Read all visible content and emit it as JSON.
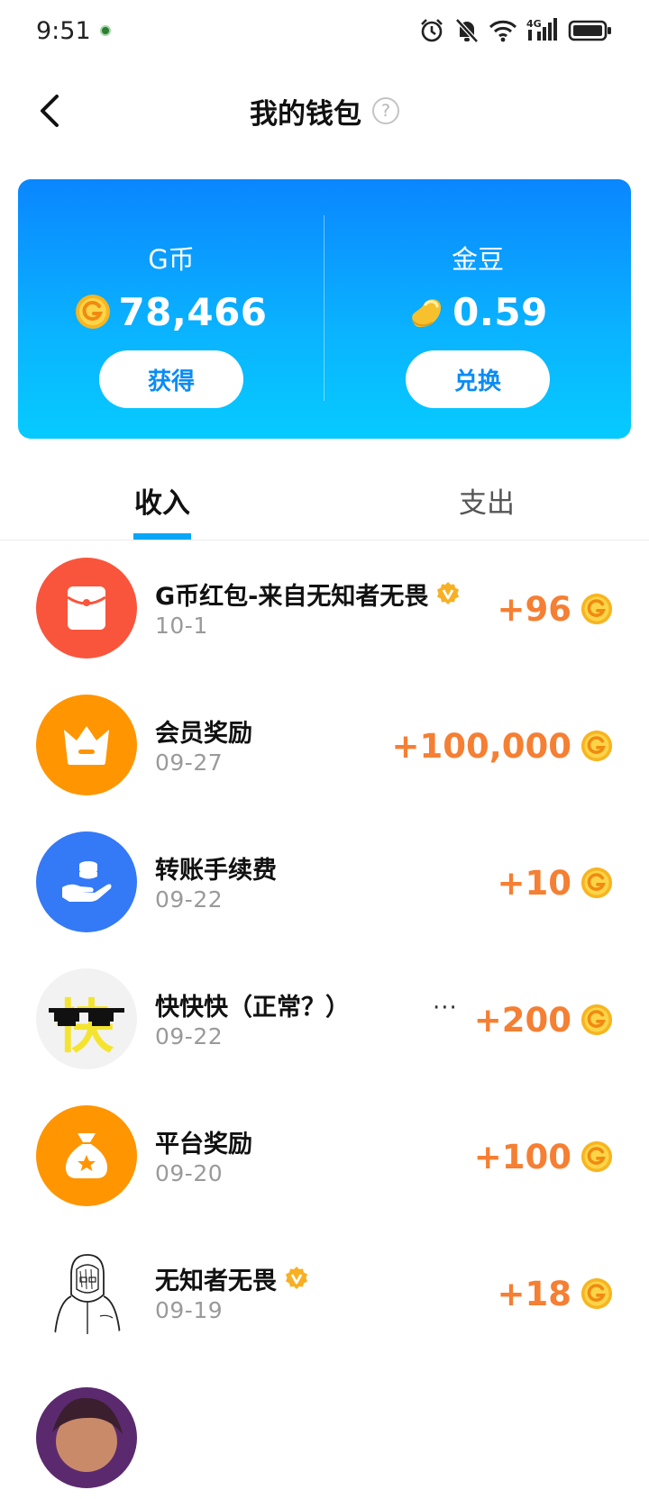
{
  "status_bar": {
    "time": "9:51",
    "icons": [
      "alarm-icon",
      "mute-icon",
      "wifi-icon",
      "signal-4g-icon",
      "battery-icon"
    ],
    "network_label": "4G"
  },
  "nav": {
    "title": "我的钱包",
    "back_icon": "chevron-left-icon",
    "help_icon": "question-circle-icon",
    "help_glyph": "?"
  },
  "wallet": {
    "gcoin": {
      "label": "G币",
      "amount": "78,466",
      "icon": "gcoin-icon",
      "button_label": "获得"
    },
    "golden_bean": {
      "label": "金豆",
      "amount": "0.59",
      "icon": "bean-icon",
      "button_label": "兑换"
    },
    "card_gradient": [
      "#0a86ff",
      "#06cbff"
    ]
  },
  "tabs": [
    {
      "label": "收入",
      "active": true
    },
    {
      "label": "支出",
      "active": false
    }
  ],
  "transactions": [
    {
      "title": "G币红包-来自无知者无畏",
      "date": "10-1",
      "amount": "+96",
      "avatar": "red-envelope-icon",
      "avatar_color": "#f9553c",
      "verified": true
    },
    {
      "title": "会员奖励",
      "date": "09-27",
      "amount": "+100,000",
      "avatar": "crown-icon",
      "avatar_color": "#ff9500",
      "verified": false
    },
    {
      "title": "转账手续费",
      "date": "09-22",
      "amount": "+10",
      "avatar": "hand-coins-icon",
      "avatar_color": "#3479f6",
      "verified": false
    },
    {
      "title": "快快快（正常？）",
      "date": "09-22",
      "amount": "+200",
      "avatar": "user-avatar-kuai",
      "avatar_color": "#f2f2f2",
      "verified": false,
      "avatar_glyph": "快",
      "more": "···"
    },
    {
      "title": "平台奖励",
      "date": "09-20",
      "amount": "+100",
      "avatar": "money-bag-icon",
      "avatar_color": "#ff9500",
      "verified": false
    },
    {
      "title": "无知者无畏",
      "date": "09-19",
      "amount": "+18",
      "avatar": "user-avatar-sketch",
      "avatar_color": "#ffffff",
      "verified": true
    }
  ],
  "colors": {
    "accent": "#0aa6f5",
    "amount": "#f57f33",
    "coin": "#f7c531"
  }
}
